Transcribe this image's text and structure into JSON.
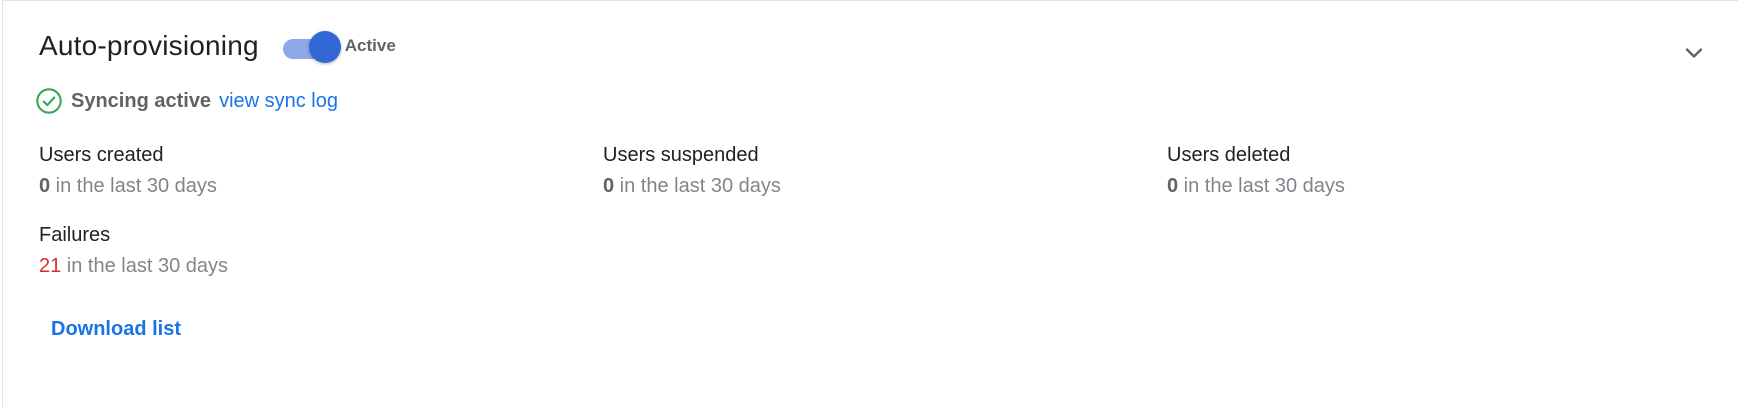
{
  "header": {
    "title": "Auto-provisioning",
    "toggle_state": "on",
    "toggle_label": "Active",
    "expand_icon": "chevron-down-icon"
  },
  "status": {
    "icon": "check-circle-icon",
    "text": "Syncing active",
    "link_label": "view sync log"
  },
  "stats": {
    "users_created": {
      "label": "Users created",
      "count": "0",
      "suffix": " in the last 30 days"
    },
    "users_suspended": {
      "label": "Users suspended",
      "count": "0",
      "suffix": " in the last 30 days"
    },
    "users_deleted": {
      "label": "Users deleted",
      "count": "0",
      "suffix": " in the last 30 days"
    },
    "failures": {
      "label": "Failures",
      "count": "21",
      "suffix": " in the last 30 days"
    }
  },
  "actions": {
    "download_label": "Download list"
  },
  "colors": {
    "accent": "#1a73e8",
    "toggle_thumb": "#3367d6",
    "toggle_track": "#8fa8ea",
    "success": "#34a853",
    "error": "#d93025"
  }
}
